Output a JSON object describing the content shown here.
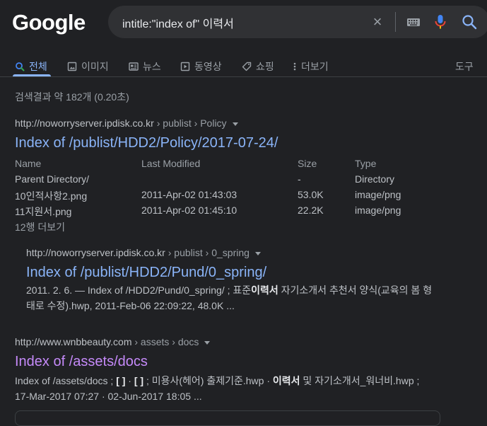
{
  "header": {
    "logo_text": "Google",
    "query": "intitle:\"index of\" 이력서",
    "clear_glyph": "×"
  },
  "tabs": [
    {
      "label": "전체",
      "icon": "search-icon"
    },
    {
      "label": "이미지",
      "icon": "image-icon"
    },
    {
      "label": "뉴스",
      "icon": "news-icon"
    },
    {
      "label": "동영상",
      "icon": "video-icon"
    },
    {
      "label": "쇼핑",
      "icon": "tag-icon"
    },
    {
      "label": "더보기",
      "icon": "more-vert-icon"
    }
  ],
  "tools_label": "도구",
  "stats": "검색결과 약 182개 (0.20초)",
  "result1": {
    "domain": "http://noworryserver.ipdisk.co.kr",
    "path": " › publist › Policy",
    "title": "Index of /publist/HDD2/Policy/2017-07-24/",
    "table": {
      "headers": [
        "Name",
        "Last Modified",
        "Size",
        "Type"
      ],
      "rows": [
        [
          "Parent Directory/",
          "",
          "-",
          "Directory"
        ],
        [
          "10인적사항2.png",
          "2011-Apr-02 01:43:03",
          "53.0K",
          "image/png"
        ],
        [
          "11지원서.png",
          "2011-Apr-02 01:45:10",
          "22.2K",
          "image/png"
        ]
      ]
    },
    "more": "12행 더보기"
  },
  "result2": {
    "domain": "http://noworryserver.ipdisk.co.kr",
    "path": " › publist › 0_spring",
    "title": "Index of /publist/HDD2/Pund/0_spring/",
    "snippet_a": "2011. 2. 6. — Index of /HDD2/Pund/0_spring/ ; 표준",
    "snippet_bold": "이력서",
    "snippet_b": " 자기소개서 추천서 양식(교육의 봄 형",
    "snippet_line2": "태로 수정).hwp, 2011-Feb-06 22:09:22, 48.0K ..."
  },
  "result3": {
    "domain": "http://www.wnbbeauty.com",
    "path": " › assets › docs",
    "title": "Index of /assets/docs",
    "snippet_a": "Index of /assets/docs ; ",
    "snippet_b1": "[ ]",
    "snippet_mid1": " · ",
    "snippet_b2": "[ ]",
    "snippet_mid2": " ; 미용사(헤어) 출제기준.hwp · ",
    "snippet_b3": "이력서",
    "snippet_end": " 및 자기소개서_워너비.hwp ;",
    "snippet_line2": "17-Mar-2017 07:27 · 02-Jun-2017 18:05 ..."
  },
  "colors": {
    "background": "#202124",
    "link": "#8ab4f8",
    "visited": "#c58af9",
    "text": "#bdc1c6"
  }
}
